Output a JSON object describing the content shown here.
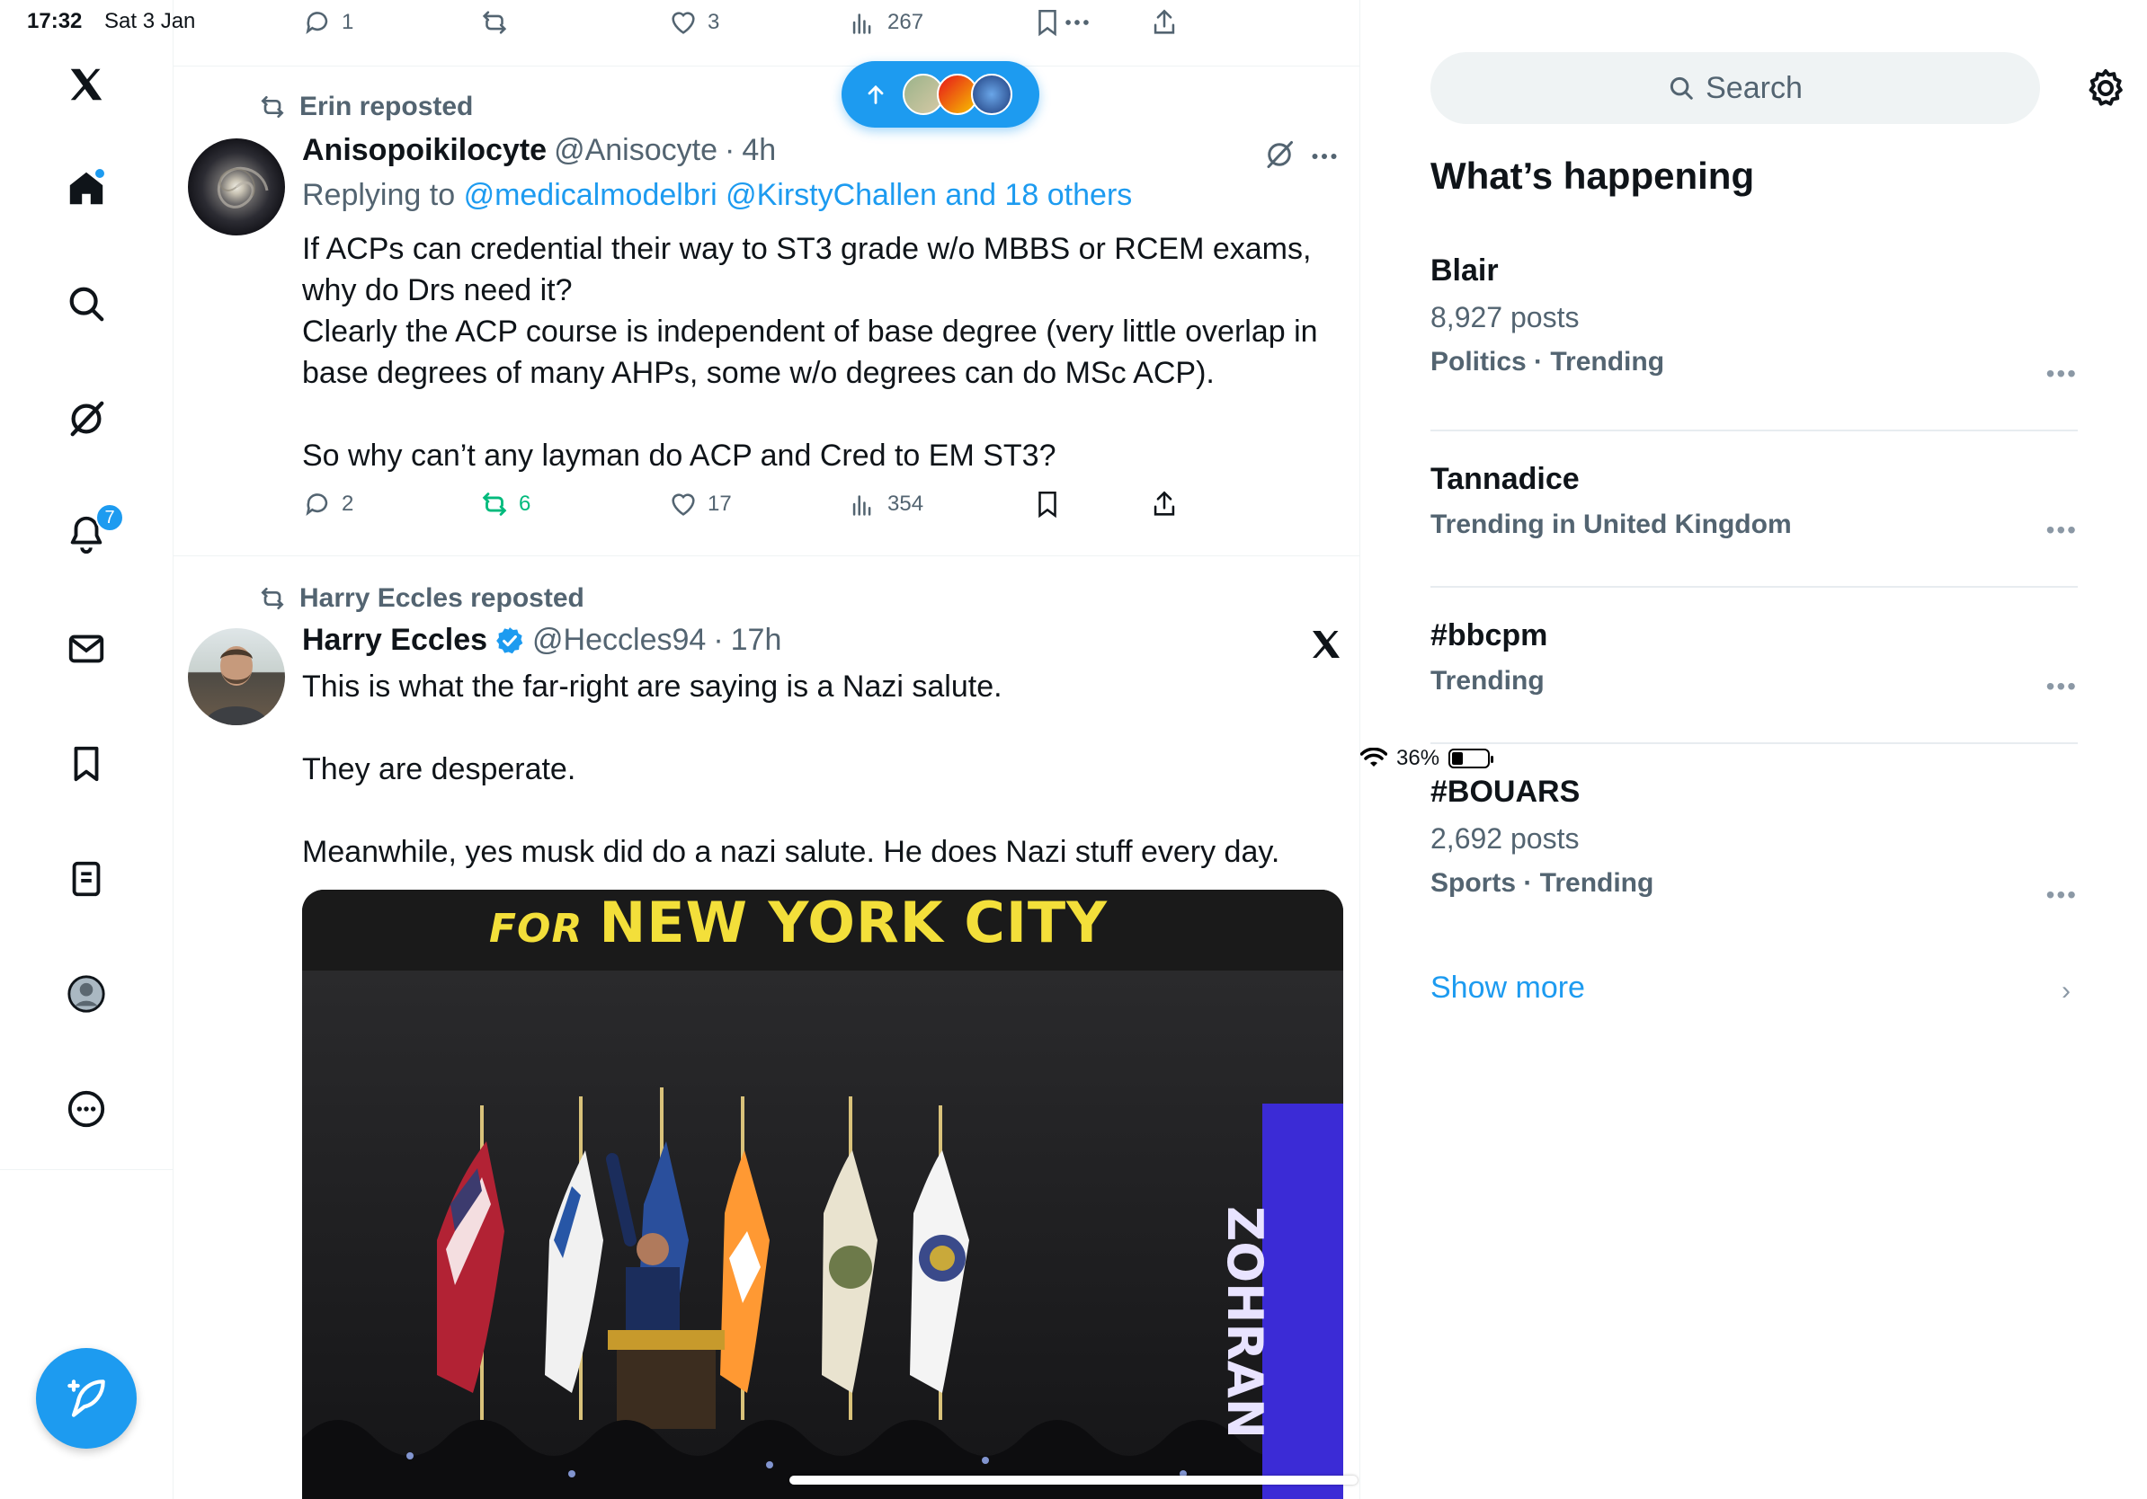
{
  "status_bar": {
    "time": "17:32",
    "date": "Sat 3 Jan",
    "battery": "36%",
    "battery_level": 0.36
  },
  "nav": {
    "items": [
      {
        "name": "x-logo-icon"
      },
      {
        "name": "home-icon"
      },
      {
        "name": "search-icon"
      },
      {
        "name": "grok-icon"
      },
      {
        "name": "notifications-icon",
        "badge": "7"
      },
      {
        "name": "messages-icon"
      },
      {
        "name": "bookmarks-icon"
      },
      {
        "name": "lists-icon"
      },
      {
        "name": "profile-icon"
      },
      {
        "name": "more-icon"
      }
    ],
    "compose_icon": "compose-feather-icon"
  },
  "top_actions": {
    "replies": "1",
    "reposts": "",
    "likes": "3",
    "views": "267"
  },
  "new_posts_pill": {
    "icon": "arrow-up-icon"
  },
  "tweets": [
    {
      "repost_by": "Erin reposted",
      "name": "Anisopoikilocyte",
      "handle": "@Anisocyte",
      "sep": "·",
      "time": "4h",
      "replying_label": "Replying to",
      "replying_links": "@medicalmodelbri @KirstyChallen and 18 others",
      "text": "If ACPs can credential their way to ST3 grade w/o MBBS or RCEM exams, why do Drs need it?\nClearly the ACP course is independent of base degree (very little overlap in base degrees of many AHPs, some w/o degrees can do MSc ACP).\n\nSo why can’t any layman do ACP and Cred to EM ST3?",
      "replies": "2",
      "reposts": "6",
      "likes": "17",
      "views": "354"
    },
    {
      "repost_by": "Harry Eccles reposted",
      "name": "Harry Eccles",
      "handle": "@Heccles94",
      "sep": "·",
      "time": "17h",
      "text": "This is what the far-right are saying is a Nazi salute.\n\nThey are desperate.\n\nMeanwhile, yes musk did do a nazi salute. He does Nazi stuff every day.",
      "media": {
        "banner_for": "FOR",
        "banner_main": "NEW YORK CITY",
        "side_text": "ZOHRAN"
      }
    }
  ],
  "sidebar": {
    "search_placeholder": "Search",
    "title": "What’s happening",
    "trends": [
      {
        "name": "Blair",
        "posts": "8,927 posts",
        "meta": "Politics · Trending"
      },
      {
        "name": "Tannadice",
        "posts": "",
        "meta": "Trending in United Kingdom"
      },
      {
        "name": "#bbcpm",
        "posts": "",
        "meta": "Trending"
      },
      {
        "name": "#BOUARS",
        "posts": "2,692 posts",
        "meta": "Sports · Trending"
      }
    ],
    "more_glyph": "•••",
    "show_more": "Show more"
  },
  "colors": {
    "accent": "#1d9bf0",
    "repost_green": "#00ba7c",
    "muted": "#536471"
  }
}
